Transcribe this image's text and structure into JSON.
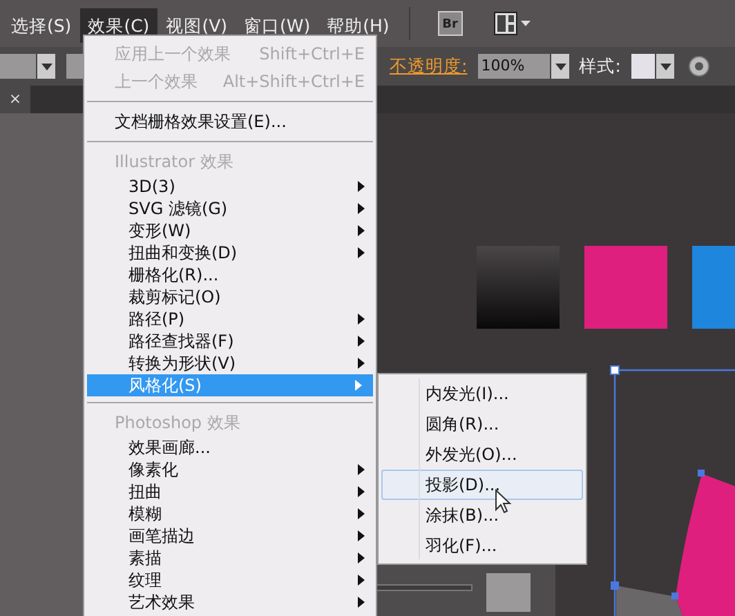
{
  "menubar": [
    {
      "label": "选择(S)",
      "selected": false
    },
    {
      "label": "效果(C)",
      "selected": true
    },
    {
      "label": "视图(V)",
      "selected": false
    },
    {
      "label": "窗口(W)",
      "selected": false
    },
    {
      "label": "帮助(H)",
      "selected": false
    }
  ],
  "bridge_button": "Br",
  "control_bar": {
    "opacity_label": "不透明度:",
    "opacity_value": "100%",
    "style_label": "样式:"
  },
  "document_tab": {
    "close": "×"
  },
  "effect_menu": {
    "items": [
      {
        "kind": "command",
        "label": "应用上一个效果",
        "shortcut": "Shift+Ctrl+E",
        "disabled": true,
        "submenu": false,
        "selected": false
      },
      {
        "kind": "command",
        "label": "上一个效果",
        "shortcut": "Alt+Shift+Ctrl+E",
        "disabled": true,
        "submenu": false,
        "selected": false
      },
      {
        "kind": "separator"
      },
      {
        "kind": "command",
        "label": "文档栅格效果设置(E)...",
        "disabled": false,
        "submenu": false,
        "selected": false
      },
      {
        "kind": "separator"
      },
      {
        "kind": "header",
        "label": "Illustrator 效果"
      },
      {
        "kind": "item",
        "label": "3D(3)",
        "disabled": false,
        "submenu": true,
        "selected": false
      },
      {
        "kind": "item",
        "label": "SVG 滤镜(G)",
        "disabled": false,
        "submenu": true,
        "selected": false
      },
      {
        "kind": "item",
        "label": "变形(W)",
        "disabled": false,
        "submenu": true,
        "selected": false
      },
      {
        "kind": "item",
        "label": "扭曲和变换(D)",
        "disabled": false,
        "submenu": true,
        "selected": false
      },
      {
        "kind": "item",
        "label": "栅格化(R)...",
        "disabled": false,
        "submenu": false,
        "selected": false
      },
      {
        "kind": "item",
        "label": "裁剪标记(O)",
        "disabled": false,
        "submenu": false,
        "selected": false
      },
      {
        "kind": "item",
        "label": "路径(P)",
        "disabled": false,
        "submenu": true,
        "selected": false
      },
      {
        "kind": "item",
        "label": "路径查找器(F)",
        "disabled": false,
        "submenu": true,
        "selected": false
      },
      {
        "kind": "item",
        "label": "转换为形状(V)",
        "disabled": false,
        "submenu": true,
        "selected": false
      },
      {
        "kind": "item",
        "label": "风格化(S)",
        "disabled": false,
        "submenu": true,
        "selected": true
      },
      {
        "kind": "separator"
      },
      {
        "kind": "header",
        "label": "Photoshop 效果"
      },
      {
        "kind": "item",
        "label": "效果画廊...",
        "disabled": false,
        "submenu": false,
        "selected": false
      },
      {
        "kind": "item",
        "label": "像素化",
        "disabled": false,
        "submenu": true,
        "selected": false
      },
      {
        "kind": "item",
        "label": "扭曲",
        "disabled": false,
        "submenu": true,
        "selected": false
      },
      {
        "kind": "item",
        "label": "模糊",
        "disabled": false,
        "submenu": true,
        "selected": false
      },
      {
        "kind": "item",
        "label": "画笔描边",
        "disabled": false,
        "submenu": true,
        "selected": false
      },
      {
        "kind": "item",
        "label": "素描",
        "disabled": false,
        "submenu": true,
        "selected": false
      },
      {
        "kind": "item",
        "label": "纹理",
        "disabled": false,
        "submenu": true,
        "selected": false
      },
      {
        "kind": "item",
        "label": "艺术效果",
        "disabled": false,
        "submenu": true,
        "selected": false
      }
    ]
  },
  "stylize_submenu": {
    "items": [
      {
        "label": "内发光(I)...",
        "selected": false
      },
      {
        "label": "圆角(R)...",
        "selected": false
      },
      {
        "label": "外发光(O)...",
        "selected": false
      },
      {
        "label": "投影(D)...",
        "selected": true
      },
      {
        "label": "涂抹(B)...",
        "selected": false
      },
      {
        "label": "羽化(F)...",
        "selected": false
      }
    ]
  },
  "swatches": [
    {
      "kind": "gradient",
      "color": "#0a0909"
    },
    {
      "kind": "solid",
      "color": "#df1f7e"
    },
    {
      "kind": "solid",
      "color": "#1e86dc"
    }
  ]
}
